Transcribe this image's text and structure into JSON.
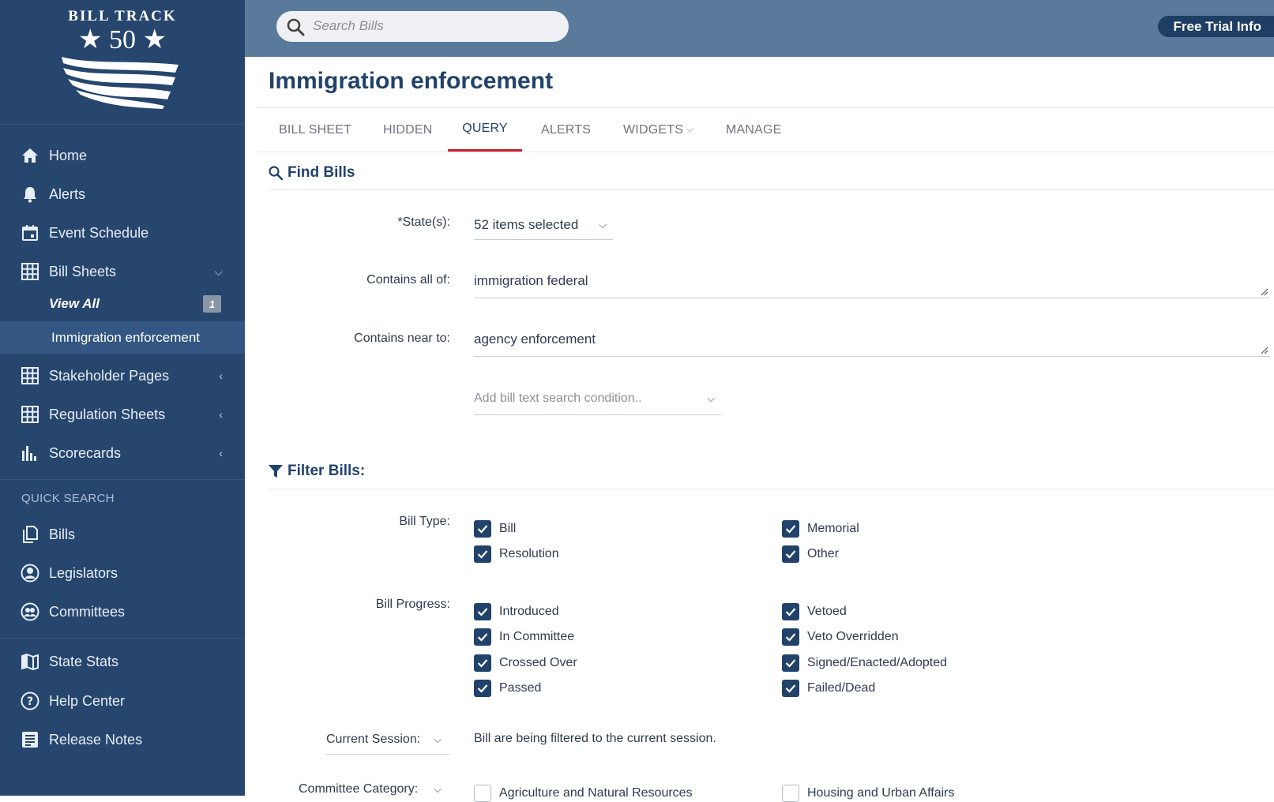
{
  "logo": {
    "line1": "BILL TRACK",
    "line2": "★ 50 ★"
  },
  "sidebar": {
    "items": [
      {
        "label": "Home",
        "icon": "home-icon"
      },
      {
        "label": "Alerts",
        "icon": "bell-icon"
      },
      {
        "label": "Event Schedule",
        "icon": "calendar-icon"
      },
      {
        "label": "Bill Sheets",
        "icon": "grid-icon",
        "chevron": "⌵"
      }
    ],
    "bill_sheets_sub": {
      "view_all": "View All",
      "view_all_badge": "1",
      "active_item": "Immigration enforcement"
    },
    "more_items": [
      {
        "label": "Stakeholder Pages",
        "icon": "grid-icon",
        "chevron": "‹"
      },
      {
        "label": "Regulation Sheets",
        "icon": "grid-icon",
        "chevron": "‹"
      },
      {
        "label": "Scorecards",
        "icon": "bar-chart-icon",
        "chevron": "‹"
      }
    ],
    "quick_search_label": "QUICK SEARCH",
    "quick_items": [
      {
        "label": "Bills",
        "icon": "document-icon"
      },
      {
        "label": "Legislators",
        "icon": "person-icon"
      },
      {
        "label": "Committees",
        "icon": "group-icon"
      }
    ],
    "bottom_items": [
      {
        "label": "State Stats",
        "icon": "map-icon"
      },
      {
        "label": "Help Center",
        "icon": "help-icon"
      },
      {
        "label": "Release Notes",
        "icon": "notes-icon"
      }
    ]
  },
  "topbar": {
    "search_placeholder": "Search Bills",
    "trial_button": "Free Trial Info"
  },
  "page": {
    "title": "Immigration enforcement",
    "tabs": [
      "BILL SHEET",
      "HIDDEN",
      "QUERY",
      "ALERTS",
      "WIDGETS",
      "MANAGE"
    ],
    "active_tab": "QUERY"
  },
  "find_bills": {
    "heading": "Find Bills",
    "states_label": "*State(s):",
    "states_value": "52 items selected",
    "contains_all_label": "Contains all of:",
    "contains_all_value": "immigration federal",
    "contains_near_label": "Contains near to:",
    "contains_near_value": "agency enforcement",
    "add_condition_placeholder": "Add bill text search condition.."
  },
  "filter_bills": {
    "heading": "Filter Bills:",
    "bill_type_label": "Bill Type:",
    "bill_type_left": [
      "Bill",
      "Resolution"
    ],
    "bill_type_right": [
      "Memorial",
      "Other"
    ],
    "bill_progress_label": "Bill Progress:",
    "bill_progress_left": [
      "Introduced",
      "In Committee",
      "Crossed Over",
      "Passed"
    ],
    "bill_progress_right": [
      "Vetoed",
      "Veto Overridden",
      "Signed/Enacted/Adopted",
      "Failed/Dead"
    ],
    "current_session_label": "Current Session:",
    "current_session_text": "Bill are being filtered to the current session.",
    "committee_category_label": "Committee Category:",
    "committee_left": "Agriculture and Natural Resources",
    "committee_right": "Housing and Urban Affairs"
  },
  "colors": {
    "sidebar": "#26466e",
    "topbar": "#5a7a9c",
    "accent": "#c8202c",
    "title": "#21426b"
  }
}
